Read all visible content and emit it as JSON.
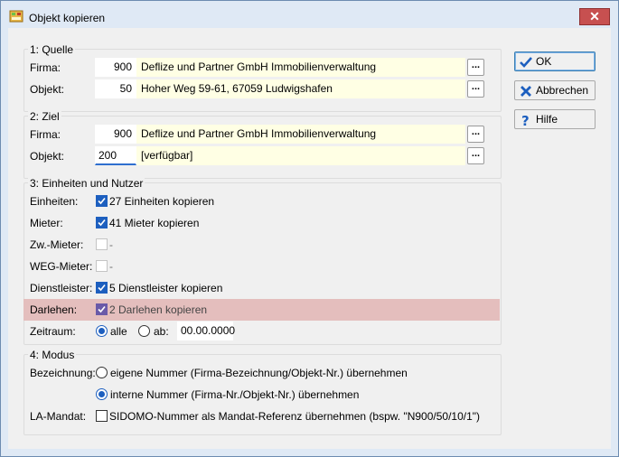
{
  "window": {
    "title": "Objekt kopieren",
    "close_glyph": "✕"
  },
  "quelle": {
    "group_title": "1: Quelle",
    "firma_label": "Firma:",
    "firma_num": "900",
    "firma_name": "Deflize und Partner GmbH Immobilienverwaltung",
    "objekt_label": "Objekt:",
    "objekt_num": "50",
    "objekt_name": "Hoher Weg 59-61, 67059 Ludwigshafen",
    "browse_label": "..."
  },
  "ziel": {
    "group_title": "2: Ziel",
    "firma_label": "Firma:",
    "firma_num": "900",
    "firma_name": "Deflize und Partner GmbH Immobilienverwaltung",
    "objekt_label": "Objekt:",
    "objekt_num": "200",
    "objekt_name": "[verfügbar]",
    "browse_label": "..."
  },
  "einheiten": {
    "group_title": "3: Einheiten und Nutzer",
    "rows": [
      {
        "label": "Einheiten:",
        "text": "27 Einheiten kopieren",
        "checked": true
      },
      {
        "label": "Mieter:",
        "text": "41 Mieter kopieren",
        "checked": true
      },
      {
        "label": "Zw.-Mieter:",
        "text": "-",
        "checked": false
      },
      {
        "label": "WEG-Mieter:",
        "text": "-",
        "checked": false
      },
      {
        "label": "Dienstleister:",
        "text": "5 Dienstleister kopieren",
        "checked": true
      },
      {
        "label": "Darlehen:",
        "text": "2 Darlehen kopieren",
        "checked": true
      }
    ],
    "zeitraum_label": "Zeitraum:",
    "alle_label": "alle",
    "ab_label": "ab:",
    "ab_date": "00.00.0000"
  },
  "modus": {
    "group_title": "4: Modus",
    "bezeichnung_label": "Bezeichnung:",
    "option1": "eigene Nummer (Firma-Bezeichnung/Objekt-Nr.) übernehmen",
    "option2": "interne Nummer (Firma-Nr./Objekt-Nr.) übernehmen",
    "lamandat_label": "LA-Mandat:",
    "lamandat_text": "SIDOMO-Nummer als Mandat-Referenz übernehmen (bspw. \"N900/50/10/1\")"
  },
  "buttons": {
    "ok": "OK",
    "abbrechen": "Abbrechen",
    "hilfe": "Hilfe"
  },
  "colors": {
    "accent": "#1d5fbf",
    "highlight_row": "#e4bebd",
    "field_yellow": "#ffffe4",
    "close_red": "#c75050"
  }
}
